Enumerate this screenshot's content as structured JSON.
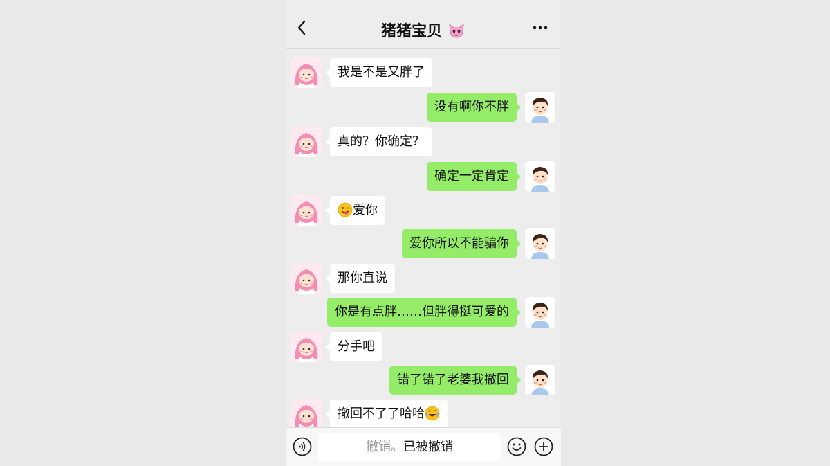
{
  "header": {
    "title": "猪猪宝贝"
  },
  "messages": [
    {
      "side": "left",
      "text": "我是不是又胖了"
    },
    {
      "side": "right",
      "text": "没有啊你不胖"
    },
    {
      "side": "left",
      "text": "真的？你确定？"
    },
    {
      "side": "right",
      "text": "确定一定肯定"
    },
    {
      "side": "left",
      "text": "爱你",
      "emoji": "tongue-wink-emoji"
    },
    {
      "side": "right",
      "text": "爱你所以不能骗你"
    },
    {
      "side": "left",
      "text": "那你直说"
    },
    {
      "side": "right",
      "text": "你是有点胖……但胖得挺可爱的"
    },
    {
      "side": "left",
      "text": "分手吧"
    },
    {
      "side": "right",
      "text": "错了错了老婆我撤回"
    },
    {
      "side": "left",
      "text": "撤回不了了哈哈",
      "emoji_after": "tears-of-joy-emoji"
    }
  ],
  "input": {
    "recall_hint": "撤销。",
    "recalled_text": "已被撤销"
  },
  "colors": {
    "sent_bubble": "#95ec69",
    "received_bubble": "#ffffff",
    "background": "#ededed"
  },
  "icons": [
    "back-arrow-icon",
    "devil-cat-emoji",
    "more-dots-icon",
    "voice-icon",
    "emoji-icon",
    "plus-icon"
  ]
}
